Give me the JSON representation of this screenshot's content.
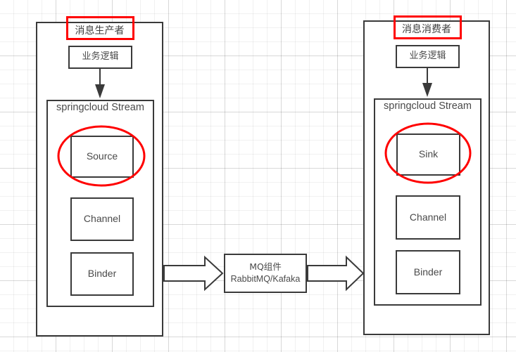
{
  "diagram": {
    "title_left": "消息生产者",
    "title_right": "消息消费者",
    "producer": {
      "header": "消息生产者",
      "business_logic": "业务逻辑",
      "stream_title": "springcloud Stream",
      "items": [
        {
          "label": "Source",
          "highlighted": true
        },
        {
          "label": "Channel",
          "highlighted": false
        },
        {
          "label": "Binder",
          "highlighted": false
        }
      ]
    },
    "consumer": {
      "header": "消息消费者",
      "business_logic": "业务逻辑",
      "stream_title": "springcloud Stream",
      "items": [
        {
          "label": "Sink",
          "highlighted": true
        },
        {
          "label": "Channel",
          "highlighted": false
        },
        {
          "label": "Binder",
          "highlighted": false
        }
      ]
    },
    "middleware": {
      "line1": "MQ组件",
      "line2": "RabbitMQ/Kafaka"
    },
    "colors": {
      "highlight": "#ff0000",
      "stroke": "#3a3a3a",
      "text": "#4a4a4a",
      "background": "#ffffff",
      "grid_minor": "#f0f0f0",
      "grid_major": "#e3e3e3"
    },
    "arrows": {
      "left_arrow_direction": "right",
      "right_arrow_direction": "right",
      "producer_internal_arrow_direction": "down",
      "consumer_internal_arrow_direction": "down"
    }
  }
}
